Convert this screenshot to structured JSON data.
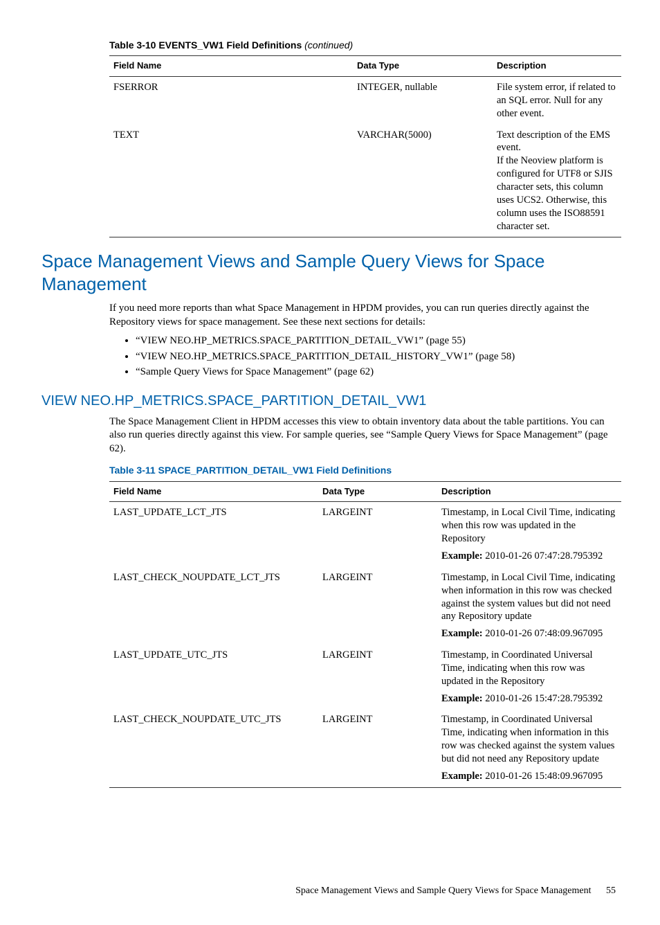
{
  "table310": {
    "title_prefix": "Table 3-10 EVENTS_VW1 Field Definitions ",
    "title_suffix": "(continued)",
    "headers": {
      "field": "Field Name",
      "type": "Data Type",
      "desc": "Description"
    },
    "rows": [
      {
        "field": "FSERROR",
        "type": "INTEGER, nullable",
        "desc": "File system error, if related to an SQL error. Null for any other event."
      },
      {
        "field": "TEXT",
        "type": "VARCHAR(5000)",
        "desc": "Text description of the EMS event.\nIf the Neoview platform is configured for UTF8 or SJIS character sets, this column uses UCS2. Otherwise, this column uses the ISO88591 character set."
      }
    ]
  },
  "h1": "Space Management Views and Sample Query Views for Space Management",
  "intro": "If you need more reports than what Space Management in HPDM provides, you can run queries directly against the Repository views for space management. See these next sections for details:",
  "links": [
    "“VIEW NEO.HP_METRICS.SPACE_PARTITION_DETAIL_VW1” (page 55)",
    "“VIEW NEO.HP_METRICS.SPACE_PARTITION_DETAIL_HISTORY_VW1” (page 58)",
    "“Sample Query Views for Space Management” (page 62)"
  ],
  "h2": "VIEW NEO.HP_METRICS.SPACE_PARTITION_DETAIL_VW1",
  "view_intro_a": "The Space Management Client in HPDM accesses this view to obtain inventory data about the table partitions. You can also run queries directly against this view. For sample queries, see ",
  "view_intro_link": "“Sample Query Views for Space Management” (page 62)",
  "view_intro_b": ".",
  "table311": {
    "title": "Table 3-11 SPACE_PARTITION_DETAIL_VW1 Field Definitions",
    "headers": {
      "field": "Field Name",
      "type": "Data Type",
      "desc": "Description"
    },
    "example_label": "Example:",
    "rows": [
      {
        "field": "LAST_UPDATE_LCT_JTS",
        "type": "LARGEINT",
        "desc": "Timestamp, in Local Civil Time, indicating when this row was updated in the Repository",
        "example": " 2010-01-26 07:47:28.795392"
      },
      {
        "field": "LAST_CHECK_NOUPDATE_LCT_JTS",
        "type": "LARGEINT",
        "desc": "Timestamp, in Local Civil Time, indicating when information in this row was checked against the system values but did not need any Repository update",
        "example": " 2010-01-26 07:48:09.967095"
      },
      {
        "field": "LAST_UPDATE_UTC_JTS",
        "type": "LARGEINT",
        "desc": "Timestamp, in Coordinated Universal Time, indicating when this row was updated in the Repository",
        "example": " 2010-01-26 15:47:28.795392"
      },
      {
        "field": "LAST_CHECK_NOUPDATE_UTC_JTS",
        "type": "LARGEINT",
        "desc": "Timestamp, in Coordinated Universal Time, indicating when information in this row was checked against the system values but did not need any Repository update",
        "example": " 2010-01-26 15:48:09.967095"
      }
    ]
  },
  "footer": {
    "text": "Space Management Views and Sample Query Views for Space Management",
    "page": "55"
  }
}
